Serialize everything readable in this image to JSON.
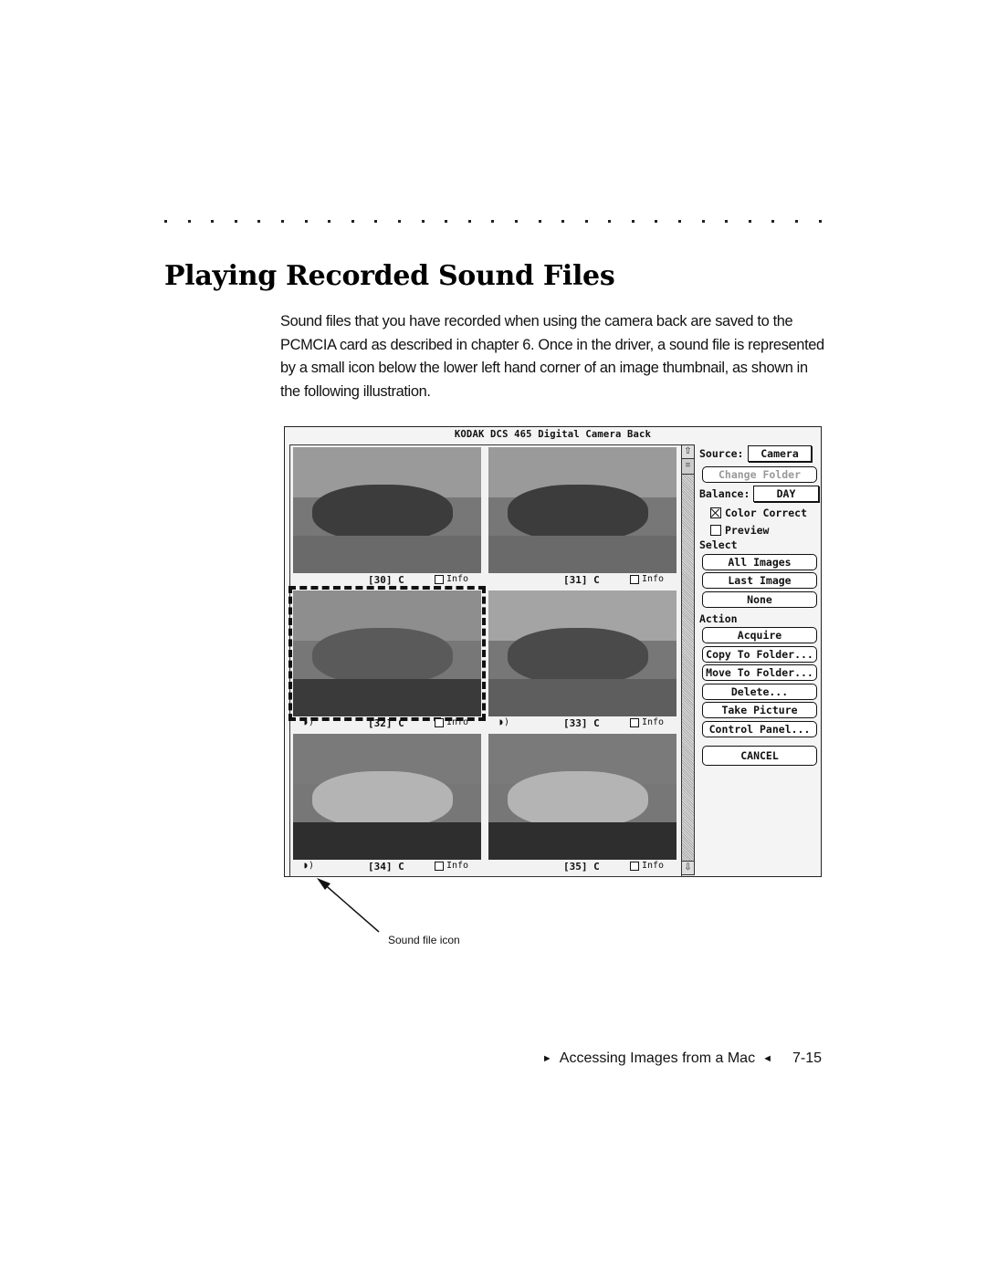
{
  "page": {
    "heading": "Playing Recorded Sound Files",
    "paragraph": "Sound files that you have recorded when using the camera back are saved to the PCMCIA card as described in chapter 6. Once in the driver, a sound file is represented by a small icon below the lower left hand corner of an image thumbnail, as shown in the following illustration.",
    "callout_label": "Sound file icon",
    "footer": {
      "left_marker": "►",
      "section": "Accessing Images from a Mac",
      "right_marker": "◄",
      "page_number": "7-15"
    }
  },
  "window": {
    "title": "KODAK DCS 465 Digital Camera Back",
    "thumbnails": [
      {
        "label": "[30] C",
        "info": "Info",
        "info_checked": false,
        "has_sound": false,
        "selected": false,
        "scene": "flowers-on-deck"
      },
      {
        "label": "[31] C",
        "info": "Info",
        "info_checked": false,
        "has_sound": false,
        "selected": false,
        "scene": "flowers-on-deck"
      },
      {
        "label": "[32] C",
        "info": "Info",
        "info_checked": false,
        "has_sound": true,
        "selected": true,
        "scene": "flowers-closeup"
      },
      {
        "label": "[33] C",
        "info": "Info",
        "info_checked": false,
        "has_sound": true,
        "selected": false,
        "scene": "plant-on-deck"
      },
      {
        "label": "[34] C",
        "info": "Info",
        "info_checked": false,
        "has_sound": true,
        "selected": false,
        "scene": "waterfall"
      },
      {
        "label": "[35] C",
        "info": "Info",
        "info_checked": false,
        "has_sound": false,
        "selected": false,
        "scene": "waterfall"
      }
    ],
    "sound_icon_glyph": "◗)",
    "scrollbar": {
      "up_glyph": "⇧",
      "down_glyph": "⇩",
      "thumb_glyph": "≡"
    },
    "panel": {
      "source_label": "Source:",
      "source_value": "Camera",
      "change_folder": "Change Folder",
      "balance_label": "Balance:",
      "balance_value": "DAY",
      "color_correct": {
        "label": "Color Correct",
        "checked": true
      },
      "preview": {
        "label": "Preview",
        "checked": false
      },
      "select_label": "Select",
      "select_buttons": [
        "All Images",
        "Last Image",
        "None"
      ],
      "action_label": "Action",
      "action_buttons": [
        "Acquire",
        "Copy To Folder...",
        "Move To Folder...",
        "Delete...",
        "Take Picture",
        "Control Panel..."
      ],
      "cancel": "CANCEL"
    }
  }
}
